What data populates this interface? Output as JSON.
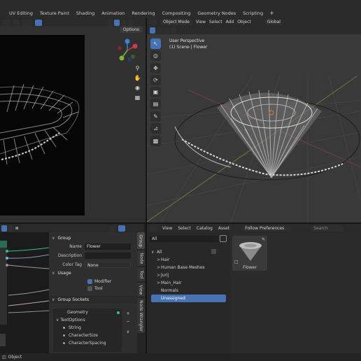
{
  "workspace_tabs": [
    "UV Editing",
    "Texture Paint",
    "Shading",
    "Animation",
    "Rendering",
    "Compositing",
    "Geometry Nodes",
    "Scripting"
  ],
  "add_tab_label": "+",
  "left_editor": {
    "options_label": "Options"
  },
  "viewport": {
    "mode_label": "Object Mode",
    "menus": [
      "View",
      "Select",
      "Add",
      "Object"
    ],
    "transform_orientation": "Global",
    "overlay_title": "User Perspective",
    "overlay_subtitle": "(1) Scene | Flower"
  },
  "properties": {
    "group_header": "Group",
    "name_label": "Name",
    "name_value": "Flower",
    "description_label": "Description",
    "description_value": "",
    "color_tag_label": "Color Tag",
    "color_tag_value": "None",
    "usage_header": "Usage",
    "modifier_label": "Modifier",
    "tool_label": "Tool",
    "sockets_header": "Group Sockets",
    "sockets": [
      {
        "name": "Geometry",
        "indent": 0
      },
      {
        "name": "TextOptions",
        "indent": 0
      },
      {
        "name": "String",
        "indent": 1
      },
      {
        "name": "CharacterSize",
        "indent": 1
      },
      {
        "name": "CharacterSpacing",
        "indent": 1
      }
    ],
    "vertical_tabs": [
      "Group",
      "Node",
      "Tool",
      "View",
      "Node Wrangler"
    ]
  },
  "asset_browser": {
    "menus": [
      "View",
      "Select",
      "Catalog",
      "Asset"
    ],
    "library": "Follow Preferences",
    "filter_value": "All",
    "search_placeholder": "Search",
    "catalogs": [
      {
        "label": "All",
        "level": 0,
        "expander": "∨"
      },
      {
        "label": "Hair",
        "level": 1,
        "expander": ">"
      },
      {
        "label": "Human Base Meshes",
        "level": 1,
        "expander": ">"
      },
      {
        "label": "Jurij",
        "level": 1,
        "expander": ">"
      },
      {
        "label": "Main_Hair",
        "level": 1,
        "expander": ">"
      },
      {
        "label": "Normals",
        "level": 1,
        "expander": ""
      },
      {
        "label": "Unassigned",
        "level": 1,
        "expander": "",
        "selected": true
      }
    ],
    "asset_name": "Flower"
  },
  "status_bar": {
    "label": "Object"
  },
  "colors": {
    "accent": "#4772b3",
    "x_axis": "#c83c4b",
    "y_axis": "#7bb33b",
    "z_axis": "#3d7fd9",
    "socket_green": "#34c191"
  }
}
